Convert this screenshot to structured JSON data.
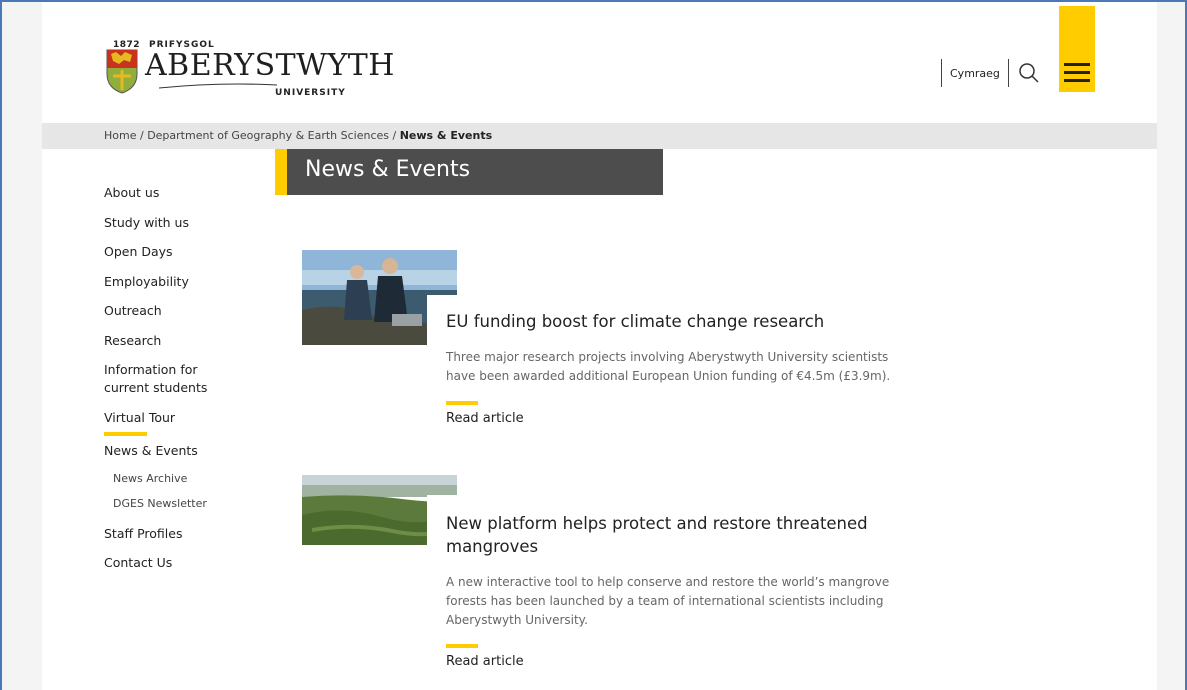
{
  "header": {
    "logo_year": "1872",
    "logo_top": "PRIFYSGOL",
    "logo_wordmark": "ABERYSTWYTH",
    "logo_bottom": "UNIVERSITY",
    "language_link": "Cymraeg",
    "accent_color": "#ffcc00"
  },
  "breadcrumb": {
    "home": "Home",
    "sep": " / ",
    "dept": "Department of Geography & Earth Sciences",
    "current": "News & Events"
  },
  "page_title": "News & Events",
  "sidebar": {
    "items": [
      {
        "label": "About us"
      },
      {
        "label": "Study with us"
      },
      {
        "label": "Open Days"
      },
      {
        "label": "Employability"
      },
      {
        "label": "Outreach"
      },
      {
        "label": "Research"
      },
      {
        "label": "Information for current students"
      },
      {
        "label": "Virtual Tour"
      },
      {
        "label": "News & Events"
      },
      {
        "label": "News Archive"
      },
      {
        "label": "DGES Newsletter"
      },
      {
        "label": "Staff Profiles"
      },
      {
        "label": "Contact Us"
      }
    ]
  },
  "articles": [
    {
      "title": "EU funding boost for climate change research",
      "summary": "Three major research projects involving Aberystwyth University scientists have been awarded additional European Union funding of €4.5m (£3.9m).",
      "link": "Read article"
    },
    {
      "title": "New platform helps protect and restore threatened mangroves",
      "summary": "A new interactive tool to help conserve and restore the world’s mangrove forests has been launched by a team of international scientists including Aberystwyth University.",
      "link": "Read article"
    }
  ]
}
